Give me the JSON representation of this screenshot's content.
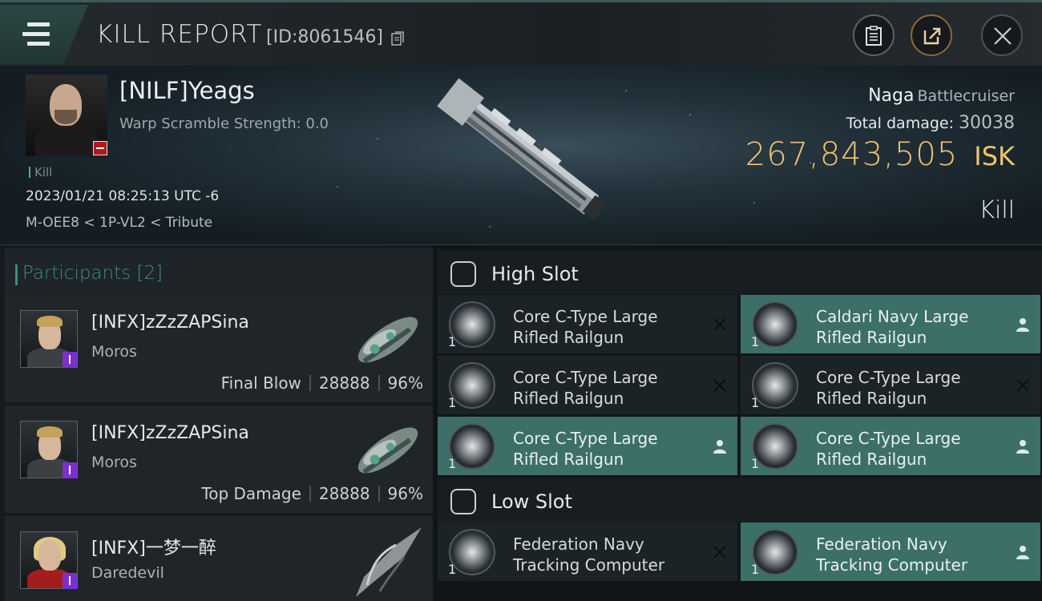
{
  "header": {
    "title": "KILL REPORT",
    "report_id": "[ID:8061546]"
  },
  "victim": {
    "name": "[NILF]Yeags",
    "warp_scramble": "Warp Scramble Strength: 0.0",
    "tag": "Kill",
    "datetime": "2023/01/21 08:25:13 UTC -6",
    "location": "M-OEE8 < 1P-VL2 < Tribute",
    "ship_name": "Naga",
    "ship_class": "Battlecruiser",
    "damage_label": "Total damage:",
    "damage_value": "30038",
    "isk_value": "267,843,505",
    "isk_unit": "ISK",
    "result": "Kill"
  },
  "participants": {
    "heading": "Participants [2]",
    "rows": [
      {
        "name": "[INFX]zZzZAPSina",
        "ship": "Moros",
        "role": "Final Blow",
        "damage": "28888",
        "percent": "96%"
      },
      {
        "name": "[INFX]zZzZAPSina",
        "ship": "Moros",
        "role": "Top Damage",
        "damage": "28888",
        "percent": "96%"
      },
      {
        "name": "[INFX]一梦一醉",
        "ship": "Daredevil",
        "role": "",
        "damage": "",
        "percent": ""
      }
    ]
  },
  "fitting": {
    "high_slot_label": "High Slot",
    "low_slot_label": "Low Slot",
    "high_slot": [
      {
        "name_line1": "Core C-Type Large",
        "name_line2": "Rifled Railgun",
        "qty": "1",
        "state": "destroyed"
      },
      {
        "name_line1": "Caldari Navy Large",
        "name_line2": "Rifled Railgun",
        "qty": "1",
        "state": "dropped"
      },
      {
        "name_line1": "Core C-Type Large",
        "name_line2": "Rifled Railgun",
        "qty": "1",
        "state": "destroyed"
      },
      {
        "name_line1": "Core C-Type Large",
        "name_line2": "Rifled Railgun",
        "qty": "1",
        "state": "destroyed"
      },
      {
        "name_line1": "Core C-Type Large",
        "name_line2": "Rifled Railgun",
        "qty": "1",
        "state": "dropped"
      },
      {
        "name_line1": "Core C-Type Large",
        "name_line2": "Rifled Railgun",
        "qty": "1",
        "state": "dropped"
      }
    ],
    "low_slot": [
      {
        "name_line1": "Federation Navy",
        "name_line2": "Tracking Computer",
        "qty": "1",
        "state": "destroyed"
      },
      {
        "name_line1": "Federation Navy",
        "name_line2": "Tracking Computer",
        "qty": "1",
        "state": "dropped"
      }
    ]
  },
  "colors": {
    "accent_teal": "#3c6f68",
    "isk_gold": "#f0c36c",
    "loss_red": "#b31919",
    "corp_purple": "#7d2fd0"
  },
  "icons": [
    "menu-icon",
    "copy-icon",
    "clipboard-icon",
    "share-icon",
    "close-icon",
    "slot-icon",
    "railgun-icon",
    "tracking-computer-icon",
    "destroyed-x-icon",
    "dropped-person-icon"
  ]
}
